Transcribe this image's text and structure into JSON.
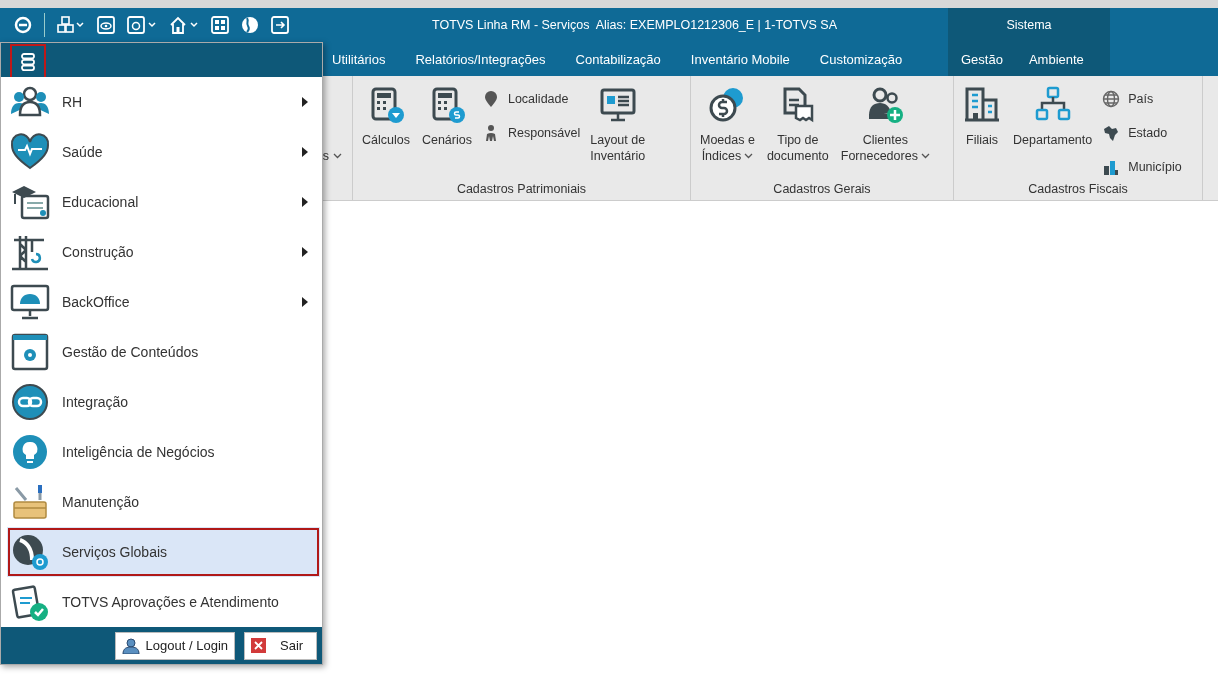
{
  "titlebar": {
    "title": "TOTVS Linha RM - Serviços  Alias: EXEMPLO1212306_E | 1-TOTVS SA",
    "context_title": "Sistema"
  },
  "tabs": [
    {
      "label": "Utilitários",
      "context": false
    },
    {
      "label": "Relatórios/Integrações",
      "context": false
    },
    {
      "label": "Contabilização",
      "context": false
    },
    {
      "label": "Inventário Mobile",
      "context": false
    },
    {
      "label": "Customização",
      "context": false
    },
    {
      "label": "Gestão",
      "context": true
    },
    {
      "label": "Ambiente",
      "context": true
    }
  ],
  "ribbon": {
    "partial_item": {
      "label": "s",
      "dropdown": true
    },
    "groups": [
      {
        "title": "Cadastros Patrimoniais",
        "items": [
          {
            "kind": "large",
            "lines": [
              "Cálculos"
            ],
            "dropdown": false
          },
          {
            "kind": "large",
            "lines": [
              "Cenários"
            ],
            "dropdown": false
          },
          {
            "kind": "stack",
            "entries": [
              "Localidade",
              "Responsável"
            ]
          },
          {
            "kind": "large",
            "lines": [
              "Layout de",
              "Inventário"
            ],
            "dropdown": false
          }
        ]
      },
      {
        "title": "Cadastros Gerais",
        "items": [
          {
            "kind": "large",
            "lines": [
              "Moedas e",
              "Índices"
            ],
            "dropdown": true
          },
          {
            "kind": "large",
            "lines": [
              "Tipo de",
              "documento"
            ],
            "dropdown": false
          },
          {
            "kind": "large",
            "lines": [
              "Clientes",
              "Fornecedores"
            ],
            "dropdown": true
          }
        ]
      },
      {
        "title": "Cadastros Fiscais",
        "items": [
          {
            "kind": "large",
            "lines": [
              "Filiais"
            ],
            "dropdown": false
          },
          {
            "kind": "large",
            "lines": [
              "Departamento"
            ],
            "dropdown": false
          },
          {
            "kind": "stack",
            "entries": [
              "País",
              "Estado",
              "Município"
            ]
          }
        ]
      }
    ]
  },
  "menu": {
    "items": [
      {
        "label": "RH",
        "submenu": true,
        "selected": false
      },
      {
        "label": "Saúde",
        "submenu": true,
        "selected": false
      },
      {
        "label": "Educacional",
        "submenu": true,
        "selected": false
      },
      {
        "label": "Construção",
        "submenu": true,
        "selected": false
      },
      {
        "label": "BackOffice",
        "submenu": true,
        "selected": false
      },
      {
        "label": "Gestão de Conteúdos",
        "submenu": false,
        "selected": false
      },
      {
        "label": "Integração",
        "submenu": false,
        "selected": false
      },
      {
        "label": "Inteligência de Negócios",
        "submenu": false,
        "selected": false
      },
      {
        "label": "Manutenção",
        "submenu": false,
        "selected": false
      },
      {
        "label": "Serviços Globais",
        "submenu": false,
        "selected": true
      },
      {
        "label": "TOTVS Aprovações e Atendimento",
        "submenu": false,
        "selected": false
      }
    ],
    "buttons": [
      {
        "label": "Logout / Login",
        "kind": "login"
      },
      {
        "label": "Sair",
        "kind": "exit"
      }
    ]
  }
}
